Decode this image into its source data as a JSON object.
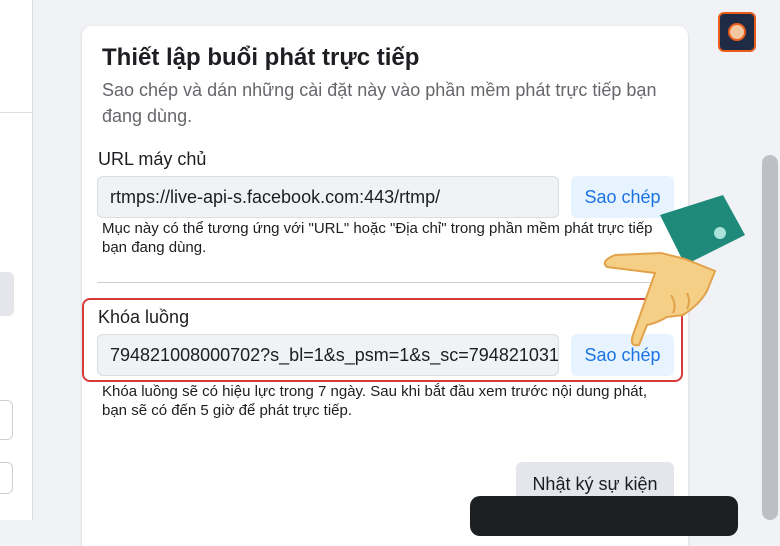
{
  "card": {
    "title": "Thiết lập buổi phát trực tiếp",
    "subtitle": "Sao chép và dán những cài đặt này vào phần mềm phát trực tiếp bạn đang dùng."
  },
  "server_url": {
    "label": "URL máy chủ",
    "value": "rtmps://live-api-s.facebook.com:443/rtmp/",
    "copy_label": "Sao chép",
    "help": "Mục này có thể tương ứng với \"URL\" hoặc \"Địa chỉ\" trong phần mềm phát trực tiếp bạn đang dùng."
  },
  "stream_key": {
    "label": "Khóa luồng",
    "value": "794821008000702?s_bl=1&s_psm=1&s_sc=794821031",
    "copy_label": "Sao chép",
    "help": "Khóa luồng sẽ có hiệu lực trong 7 ngày. Sau khi bắt đầu xem trước nội dung phát, bạn sẽ có đến 5 giờ để phát trực tiếp."
  },
  "events_button": {
    "label": "Nhật ký sự kiện"
  },
  "icons": {
    "logo": "brand-logo-icon",
    "pointer": "pointing-hand-icon"
  },
  "colors": {
    "accent": "#1b74e4",
    "highlight": "#d63a3a",
    "teal_sleeve": "#1f8a7a"
  }
}
